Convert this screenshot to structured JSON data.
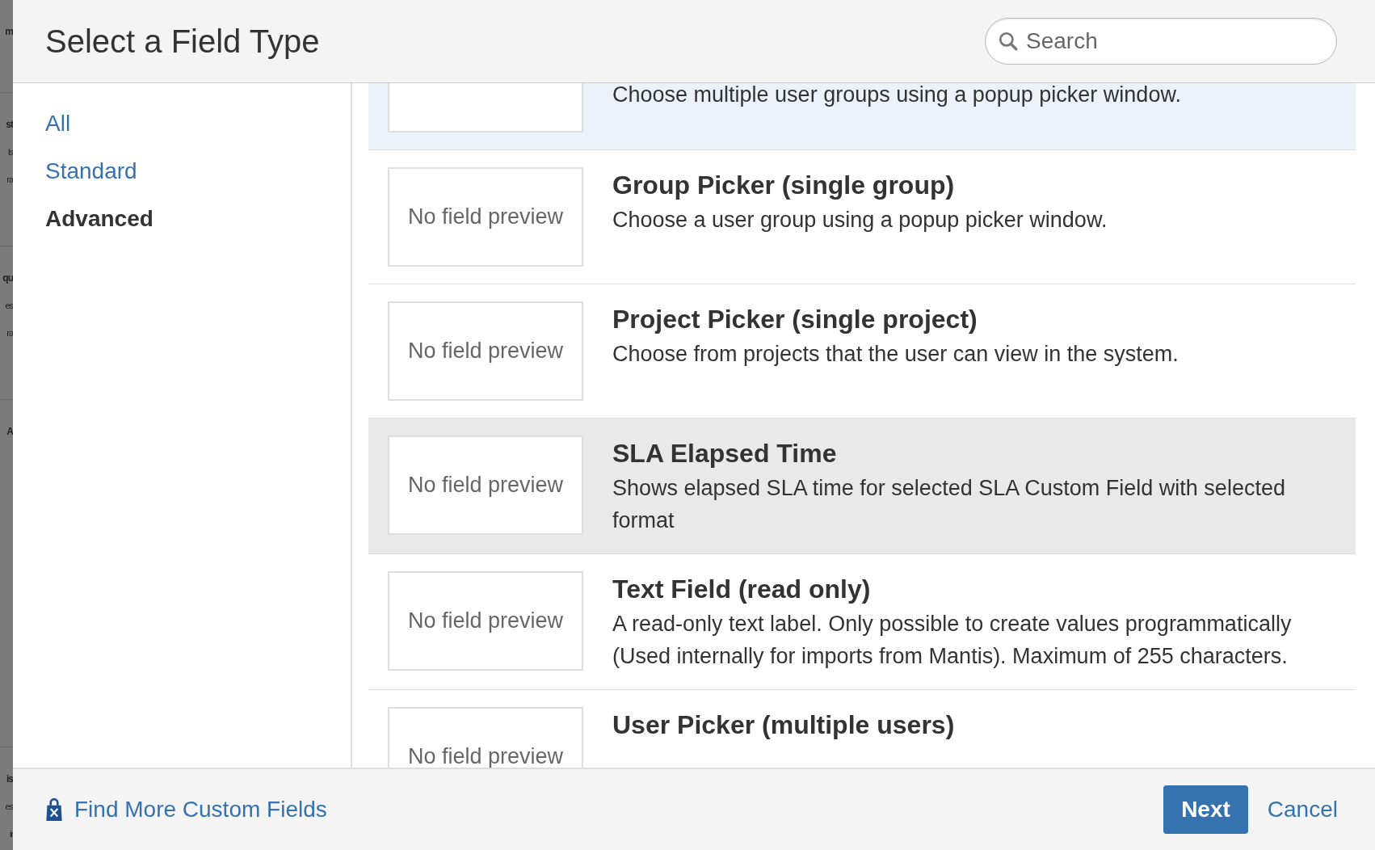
{
  "background_page": [
    {
      "lines": [
        "m"
      ]
    },
    {
      "lines": [
        "st",
        "ls",
        "ra"
      ]
    },
    {
      "lines": [
        "qu",
        "es",
        "ra"
      ]
    },
    {
      "lines": [
        "A"
      ]
    },
    {
      "lines": [
        "is",
        "es",
        "ir"
      ]
    }
  ],
  "dialog": {
    "title": "Select a Field Type",
    "search": {
      "placeholder": "Search"
    }
  },
  "sidebar": {
    "items": [
      {
        "label": "All",
        "selected": false
      },
      {
        "label": "Standard",
        "selected": false
      },
      {
        "label": "Advanced",
        "selected": true
      }
    ]
  },
  "field_types": [
    {
      "description": "Choose multiple user groups using a popup picker window.",
      "selected": true,
      "hovered": false
    },
    {
      "preview": "No field preview",
      "name": "Group Picker (single group)",
      "description": "Choose a user group using a popup picker window.",
      "selected": false,
      "hovered": false
    },
    {
      "preview": "No field preview",
      "name": "Project Picker (single project)",
      "description": "Choose from projects that the user can view in the system.",
      "selected": false,
      "hovered": false
    },
    {
      "preview": "No field preview",
      "name": "SLA Elapsed Time",
      "description": "Shows elapsed SLA time for selected SLA Custom Field with selected format",
      "selected": false,
      "hovered": true
    },
    {
      "preview": "No field preview",
      "name": "Text Field (read only)",
      "description": "A read-only text label. Only possible to create values programmatically (Used internally for imports from Mantis). Maximum of 255 characters.",
      "selected": false,
      "hovered": false
    },
    {
      "preview": "No field preview",
      "name": "User Picker (multiple users)",
      "selected": false,
      "hovered": false
    }
  ],
  "footer": {
    "link": "Find More Custom Fields",
    "buttons": [
      {
        "label": "Next",
        "kind": "primary"
      },
      {
        "label": "Cancel",
        "kind": "link"
      }
    ]
  }
}
